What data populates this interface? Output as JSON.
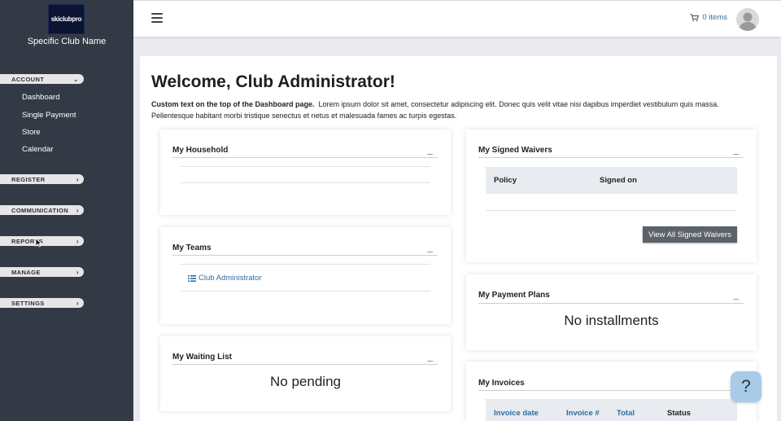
{
  "sidebar": {
    "logo_text": "skiclubpro",
    "club_name": "Specific Club Name",
    "account_label": "ACCOUNT",
    "account_items": [
      "Dashboard",
      "Single Payment",
      "Store",
      "Calendar"
    ],
    "register_label": "REGISTER",
    "communication_label": "COMMUNICATION",
    "reports_label": "REPORTS",
    "manage_label": "MANAGE",
    "settings_label": "SETTINGS"
  },
  "topbar": {
    "cart_label": "0 items"
  },
  "main": {
    "welcome": "Welcome, Club Administrator!",
    "intro_bold": "Custom text on the top of the Dashboard page.",
    "intro_text": "Lorem ipsum dolor sit amet, consectetur adipiscing elit. Donec quis velit vitae nisi dapibus imperdiet vestibulum quis massa. Pellentesque habitant morbi tristique senectus et netus et malesuada fames ac turpis egestas."
  },
  "cards": {
    "household": {
      "title": "My Household",
      "toggle": "_"
    },
    "teams": {
      "title": "My Teams",
      "toggle": "_",
      "link": "Club Administrator"
    },
    "waiting": {
      "title": "My Waiting List",
      "toggle": "_",
      "empty": "No pending"
    },
    "waivers": {
      "title": "My Signed Waivers",
      "toggle": "_",
      "col_policy": "Policy",
      "col_signed": "Signed on",
      "button": "View All Signed Waivers"
    },
    "payment_plans": {
      "title": "My Payment Plans",
      "toggle": "_",
      "empty": "No installments"
    },
    "invoices": {
      "title": "My Invoices",
      "col_date": "Invoice date",
      "col_num": "Invoice #",
      "col_total": "Total",
      "col_status": "Status"
    }
  },
  "help": {
    "label": "?"
  },
  "colors": {
    "sidebar_bg": "#343a45",
    "link": "#2d6da3",
    "help_bg": "#a7cbe9"
  }
}
